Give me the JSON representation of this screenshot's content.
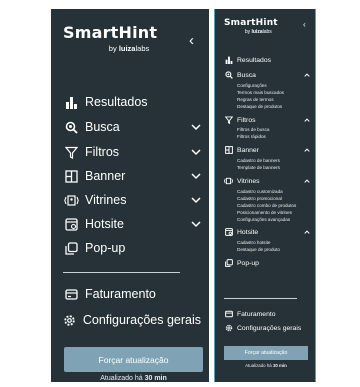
{
  "brand": {
    "name": "SmartHint",
    "sub_prefix": "by",
    "sub_brand": "luiza",
    "sub_suffix": "labs"
  },
  "collapse_glyph": "‹",
  "nav": {
    "resultados": "Resultados",
    "busca": "Busca",
    "filtros": "Filtros",
    "banner": "Banner",
    "vitrines": "Vitrines",
    "hotsite": "Hotsite",
    "popup": "Pop-up",
    "faturamento": "Faturamento",
    "configuracoes": "Configurações gerais"
  },
  "submenus": {
    "busca": [
      "Configurações",
      "Termos mais buscados",
      "Regras de termos",
      "Destaque de produtos"
    ],
    "filtros": [
      "Filtros de busca",
      "Filtros rápidos"
    ],
    "banner": [
      "Cadastro de banners",
      "Template de banners"
    ],
    "vitrines": [
      "Cadastro customizada",
      "Cadastro promocional",
      "Cadastro combo de produtos",
      "Posicionamento de vitrines",
      "Configurações avançadas"
    ],
    "hotsite": [
      "Cadastro hotsite",
      "Destaque de produto"
    ]
  },
  "refresh_button": "Forçar atualização",
  "updated": {
    "prefix": "Atualizado há",
    "value": "30 min"
  },
  "colors": {
    "sidebar_bg": "#263138",
    "button_bg": "#7fa3b5",
    "text": "#ffffff",
    "divider": "#c9d1d6"
  },
  "icons": {
    "resultados": "bar-chart-icon",
    "busca": "search-icon",
    "filtros": "filter-icon",
    "banner": "banner-icon",
    "vitrines": "showcase-icon",
    "hotsite": "hotsite-icon",
    "popup": "popup-icon",
    "faturamento": "billing-icon",
    "configuracoes": "gear-icon"
  }
}
